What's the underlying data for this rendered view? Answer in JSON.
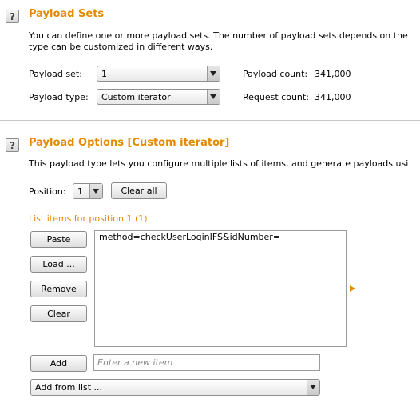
{
  "payload_sets": {
    "help_icon": "?",
    "title": "Payload Sets",
    "description_line1": "You can define one or more payload sets. The number of payload sets depends on the",
    "description_line2": "type can be customized in different ways.",
    "payload_set_label": "Payload set:",
    "payload_set_value": "1",
    "payload_type_label": "Payload type:",
    "payload_type_value": "Custom iterator",
    "payload_count_label": "Payload count:",
    "payload_count_value": "341,000",
    "request_count_label": "Request count:",
    "request_count_value": "341,000"
  },
  "payload_options": {
    "help_icon": "?",
    "title": "Payload Options [Custom iterator]",
    "description": "This payload type lets you configure multiple lists of items, and generate payloads usi",
    "position_label": "Position:",
    "position_value": "1",
    "clear_all_label": "Clear all",
    "list_heading": "List items for position 1 (1)",
    "buttons": {
      "paste": "Paste",
      "load": "Load ...",
      "remove": "Remove",
      "clear": "Clear",
      "add": "Add"
    },
    "list_items": [
      "method=checkUserLoginIFS&idNumber="
    ],
    "new_item_placeholder": "Enter a new item",
    "add_from_list_value": "Add from list ..."
  },
  "colors": {
    "accent": "#e58900"
  }
}
